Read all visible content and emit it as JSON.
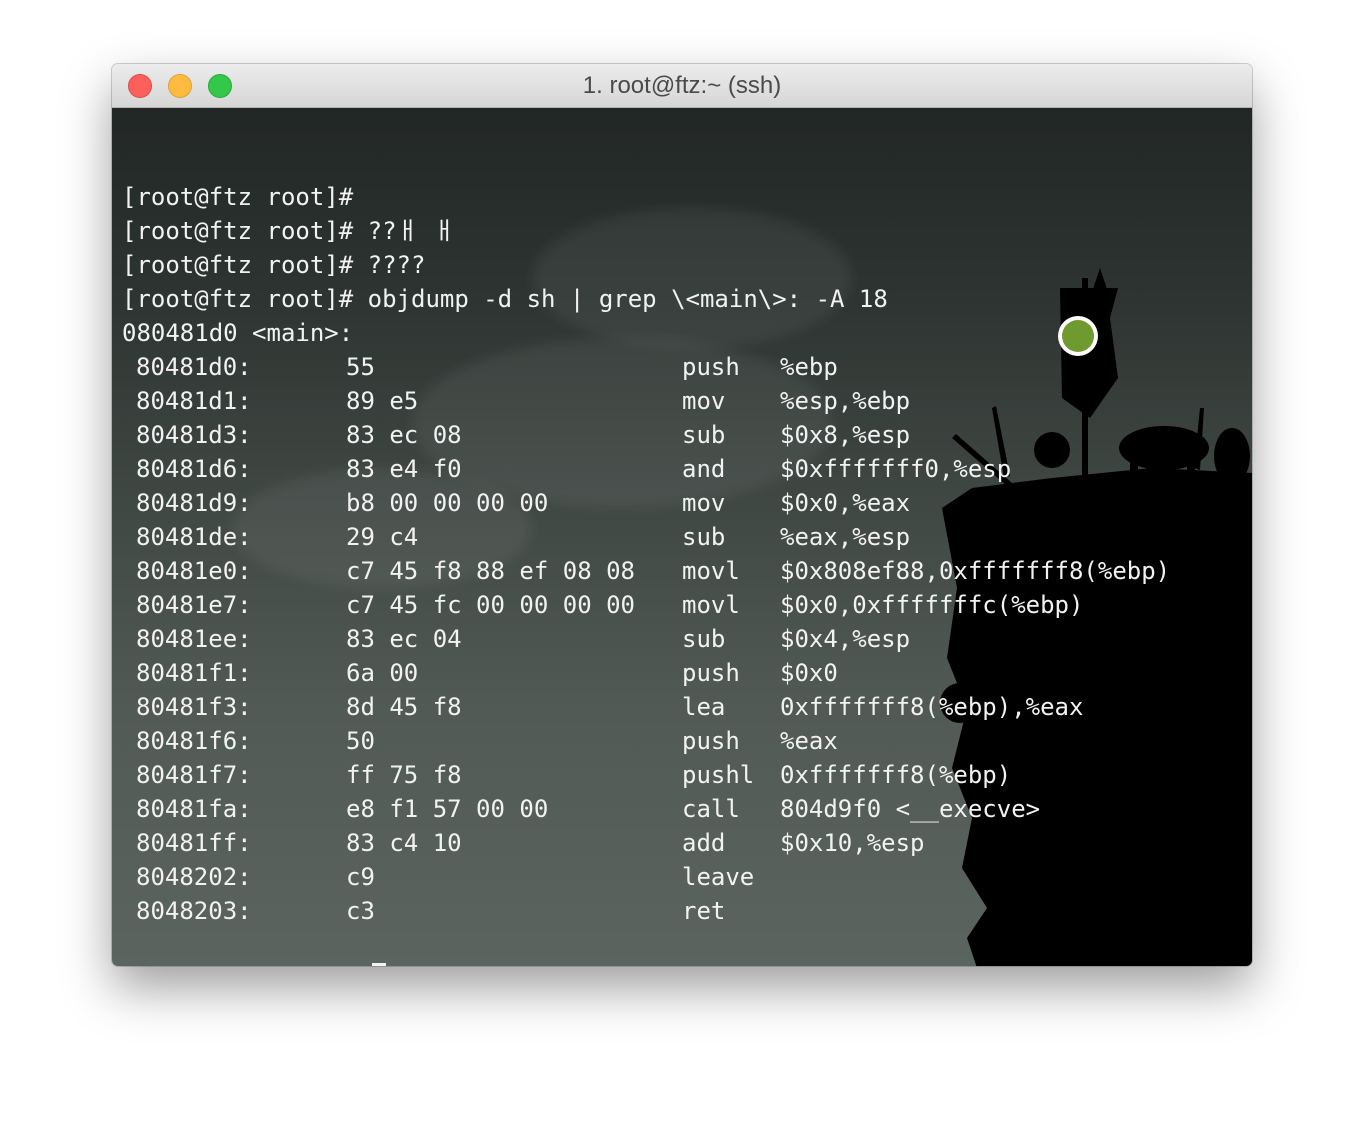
{
  "window": {
    "title": "1. root@ftz:~ (ssh)"
  },
  "terminal": {
    "prompt": "[root@ftz root]#",
    "commands": [
      "",
      "??ㅐ ㅐ",
      "????",
      "objdump -d sh | grep \\<main\\>: -A 18"
    ],
    "label_line": "080481d0 <main>:",
    "disassembly": [
      {
        "addr": "80481d0:",
        "bytes": "55",
        "op": "push",
        "args": "%ebp"
      },
      {
        "addr": "80481d1:",
        "bytes": "89 e5",
        "op": "mov",
        "args": "%esp,%ebp"
      },
      {
        "addr": "80481d3:",
        "bytes": "83 ec 08",
        "op": "sub",
        "args": "$0x8,%esp"
      },
      {
        "addr": "80481d6:",
        "bytes": "83 e4 f0",
        "op": "and",
        "args": "$0xfffffff0,%esp"
      },
      {
        "addr": "80481d9:",
        "bytes": "b8 00 00 00 00",
        "op": "mov",
        "args": "$0x0,%eax"
      },
      {
        "addr": "80481de:",
        "bytes": "29 c4",
        "op": "sub",
        "args": "%eax,%esp"
      },
      {
        "addr": "80481e0:",
        "bytes": "c7 45 f8 88 ef 08 08",
        "op": "movl",
        "args": "$0x808ef88,0xfffffff8(%ebp)"
      },
      {
        "addr": "80481e7:",
        "bytes": "c7 45 fc 00 00 00 00",
        "op": "movl",
        "args": "$0x0,0xfffffffc(%ebp)"
      },
      {
        "addr": "80481ee:",
        "bytes": "83 ec 04",
        "op": "sub",
        "args": "$0x4,%esp"
      },
      {
        "addr": "80481f1:",
        "bytes": "6a 00",
        "op": "push",
        "args": "$0x0"
      },
      {
        "addr": "80481f3:",
        "bytes": "8d 45 f8",
        "op": "lea",
        "args": "0xfffffff8(%ebp),%eax"
      },
      {
        "addr": "80481f6:",
        "bytes": "50",
        "op": "push",
        "args": "%eax"
      },
      {
        "addr": "80481f7:",
        "bytes": "ff 75 f8",
        "op": "pushl",
        "args": "0xfffffff8(%ebp)"
      },
      {
        "addr": "80481fa:",
        "bytes": "e8 f1 57 00 00",
        "op": "call",
        "args": "804d9f0 <__execve>"
      },
      {
        "addr": "80481ff:",
        "bytes": "83 c4 10",
        "op": "add",
        "args": "$0x10,%esp"
      },
      {
        "addr": "8048202:",
        "bytes": "c9",
        "op": "leave",
        "args": ""
      },
      {
        "addr": "8048203:",
        "bytes": "c3",
        "op": "ret",
        "args": ""
      }
    ]
  },
  "colors": {
    "text": "#f2f2f2",
    "close": "#fc605c",
    "minimize": "#fdbc40",
    "zoom": "#34c84a"
  }
}
